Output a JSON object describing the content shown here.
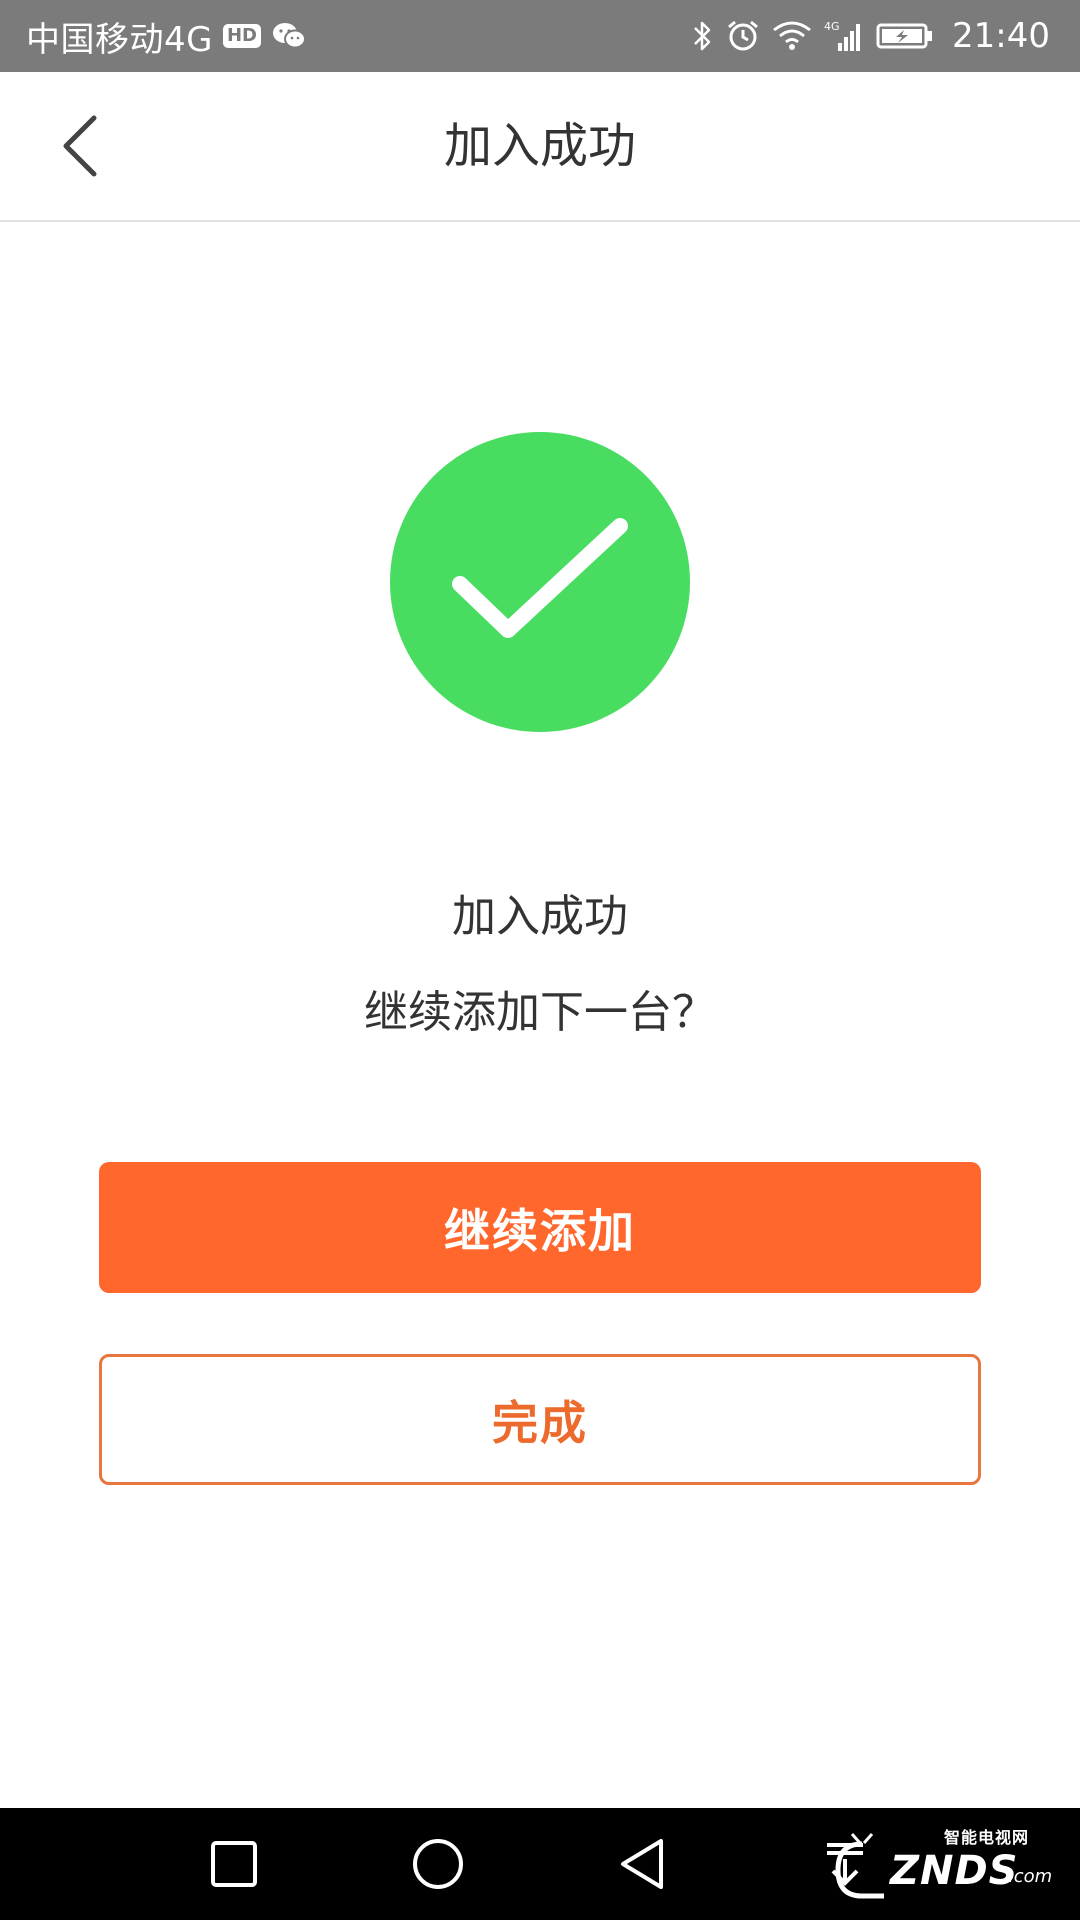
{
  "status_bar": {
    "carrier": "中国移动4G",
    "hd_badge": "HD",
    "time": "21:40",
    "icons": [
      "hd-icon",
      "wechat-icon",
      "bluetooth-icon",
      "alarm-icon",
      "wifi-icon",
      "4g-signal-icon",
      "battery-charging-icon"
    ],
    "background": "#7b7b7b"
  },
  "header": {
    "title": "加入成功",
    "back_icon": "chevron-left-icon"
  },
  "main": {
    "success_icon": "check-circle-icon",
    "success_color": "#48dc60",
    "message_title": "加入成功",
    "message_subtitle": "继续添加下一台？",
    "continue_button_label": "继续添加",
    "done_button_label": "完成",
    "accent_color": "#ff672c"
  },
  "nav_bar": {
    "buttons": [
      "recent-apps-icon",
      "home-icon",
      "back-icon",
      "download-icon"
    ],
    "watermark_small": "智能电视网",
    "watermark_brand": "ZNDS",
    "watermark_suffix": ".com"
  }
}
